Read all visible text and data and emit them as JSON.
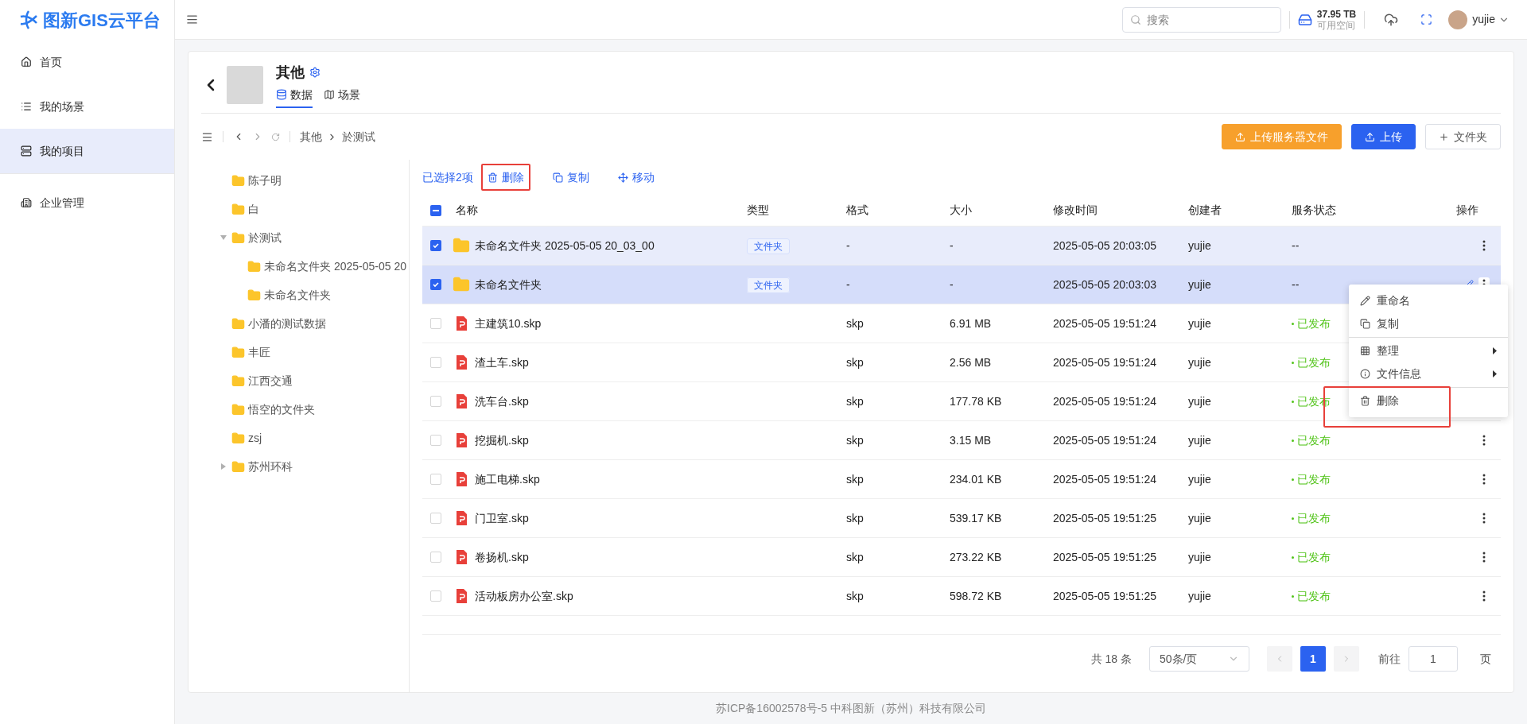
{
  "app": {
    "name": "图新GIS云平台"
  },
  "top_bar": {
    "search": {
      "placeholder": "搜索"
    },
    "storage": {
      "amount": "37.95 TB",
      "label": "可用空间"
    },
    "user": {
      "name": "yujie"
    }
  },
  "sidebar": {
    "items": [
      {
        "label": "首页",
        "selected": false
      },
      {
        "label": "我的场景",
        "selected": false
      },
      {
        "label": "我的项目",
        "selected": true
      },
      {
        "label": "企业管理",
        "selected": false
      }
    ]
  },
  "project": {
    "title": "其他",
    "tabs": [
      {
        "label": "数据",
        "selected": true
      },
      {
        "label": "场景",
        "selected": false
      }
    ]
  },
  "breadcrumb": [
    "其他",
    "於测试"
  ],
  "actions": [
    {
      "label": "上传服务器文件",
      "kind": "upload-server"
    },
    {
      "label": "上传",
      "kind": "upload"
    },
    {
      "label": "文件夹",
      "kind": "folder"
    }
  ],
  "tree": [
    {
      "label": "陈子明"
    },
    {
      "label": "白"
    },
    {
      "label": "於测试",
      "expanded": true,
      "children": [
        {
          "label": "未命名文件夹 2025-05-05 20"
        },
        {
          "label": "未命名文件夹"
        }
      ]
    },
    {
      "label": "小潘的测试数据"
    },
    {
      "label": "丰匠"
    },
    {
      "label": "江西交通"
    },
    {
      "label": "悟空的文件夹"
    },
    {
      "label": "zsj"
    },
    {
      "label": "苏州环科",
      "expanded": false
    }
  ],
  "selection_bar": {
    "count": "已选择2项",
    "actions": [
      {
        "label": "删除",
        "highlighted": true
      },
      {
        "label": "复制",
        "highlighted": false
      },
      {
        "label": "移动",
        "highlighted": false
      }
    ]
  },
  "table": {
    "select_all": {
      "indeterminate": true
    },
    "columns": [
      "名称",
      "类型",
      "格式",
      "大小",
      "修改时间",
      "创建者",
      "服务状态",
      "操作"
    ],
    "rows": [
      {
        "name": "未命名文件夹 2025-05-05 20_03_00",
        "kind": "folder",
        "type": "文件夹",
        "format": "-",
        "size": "-",
        "modified": "2025-05-05 20:03:05",
        "creator": "yujie",
        "status": "--",
        "published": false,
        "checked": true,
        "hovered": false
      },
      {
        "name": "未命名文件夹",
        "kind": "folder",
        "type": "文件夹",
        "format": "-",
        "size": "-",
        "modified": "2025-05-05 20:03:03",
        "creator": "yujie",
        "status": "--",
        "published": false,
        "checked": true,
        "hovered": true
      },
      {
        "name": "主建筑10.skp",
        "kind": "file",
        "format": "skp",
        "size": "6.91 MB",
        "modified": "2025-05-05 19:51:24",
        "creator": "yujie",
        "status": "已发布",
        "published": true,
        "checked": false,
        "hovered": false
      },
      {
        "name": "渣土车.skp",
        "kind": "file",
        "format": "skp",
        "size": "2.56 MB",
        "modified": "2025-05-05 19:51:24",
        "creator": "yujie",
        "status": "已发布",
        "published": true,
        "checked": false,
        "hovered": false
      },
      {
        "name": "洗车台.skp",
        "kind": "file",
        "format": "skp",
        "size": "177.78 KB",
        "modified": "2025-05-05 19:51:24",
        "creator": "yujie",
        "status": "已发布",
        "published": true,
        "checked": false,
        "hovered": false
      },
      {
        "name": "挖掘机.skp",
        "kind": "file",
        "format": "skp",
        "size": "3.15 MB",
        "modified": "2025-05-05 19:51:24",
        "creator": "yujie",
        "status": "已发布",
        "published": true,
        "checked": false,
        "hovered": false
      },
      {
        "name": "施工电梯.skp",
        "kind": "file",
        "format": "skp",
        "size": "234.01 KB",
        "modified": "2025-05-05 19:51:24",
        "creator": "yujie",
        "status": "已发布",
        "published": true,
        "checked": false,
        "hovered": false
      },
      {
        "name": "门卫室.skp",
        "kind": "file",
        "format": "skp",
        "size": "539.17 KB",
        "modified": "2025-05-05 19:51:25",
        "creator": "yujie",
        "status": "已发布",
        "published": true,
        "checked": false,
        "hovered": false
      },
      {
        "name": "卷扬机.skp",
        "kind": "file",
        "format": "skp",
        "size": "273.22 KB",
        "modified": "2025-05-05 19:51:25",
        "creator": "yujie",
        "status": "已发布",
        "published": true,
        "checked": false,
        "hovered": false
      },
      {
        "name": "活动板房办公室.skp",
        "kind": "file",
        "format": "skp",
        "size": "598.72 KB",
        "modified": "2025-05-05 19:51:25",
        "creator": "yujie",
        "status": "已发布",
        "published": true,
        "checked": false,
        "hovered": false
      }
    ]
  },
  "context_menu": {
    "groups": [
      [
        {
          "label": "重命名",
          "kind": "rename",
          "submenu": false,
          "highlighted": false
        },
        {
          "label": "复制",
          "kind": "copy",
          "submenu": false,
          "highlighted": false
        }
      ],
      [
        {
          "label": "整理",
          "kind": "organize",
          "submenu": true,
          "highlighted": false
        },
        {
          "label": "文件信息",
          "kind": "info",
          "submenu": true,
          "highlighted": false
        }
      ],
      [
        {
          "label": "删除",
          "kind": "delete",
          "submenu": false,
          "highlighted": true
        }
      ]
    ]
  },
  "pagination": {
    "total": "共 18 条",
    "page_size": "50条/页",
    "pages": [
      {
        "label": "1",
        "selected": true
      }
    ],
    "goto_label": "前往",
    "goto_value": "1",
    "goto_suffix": "页"
  },
  "footer": "苏ICP备16002578号-5 中科图新（苏州）科技有限公司"
}
